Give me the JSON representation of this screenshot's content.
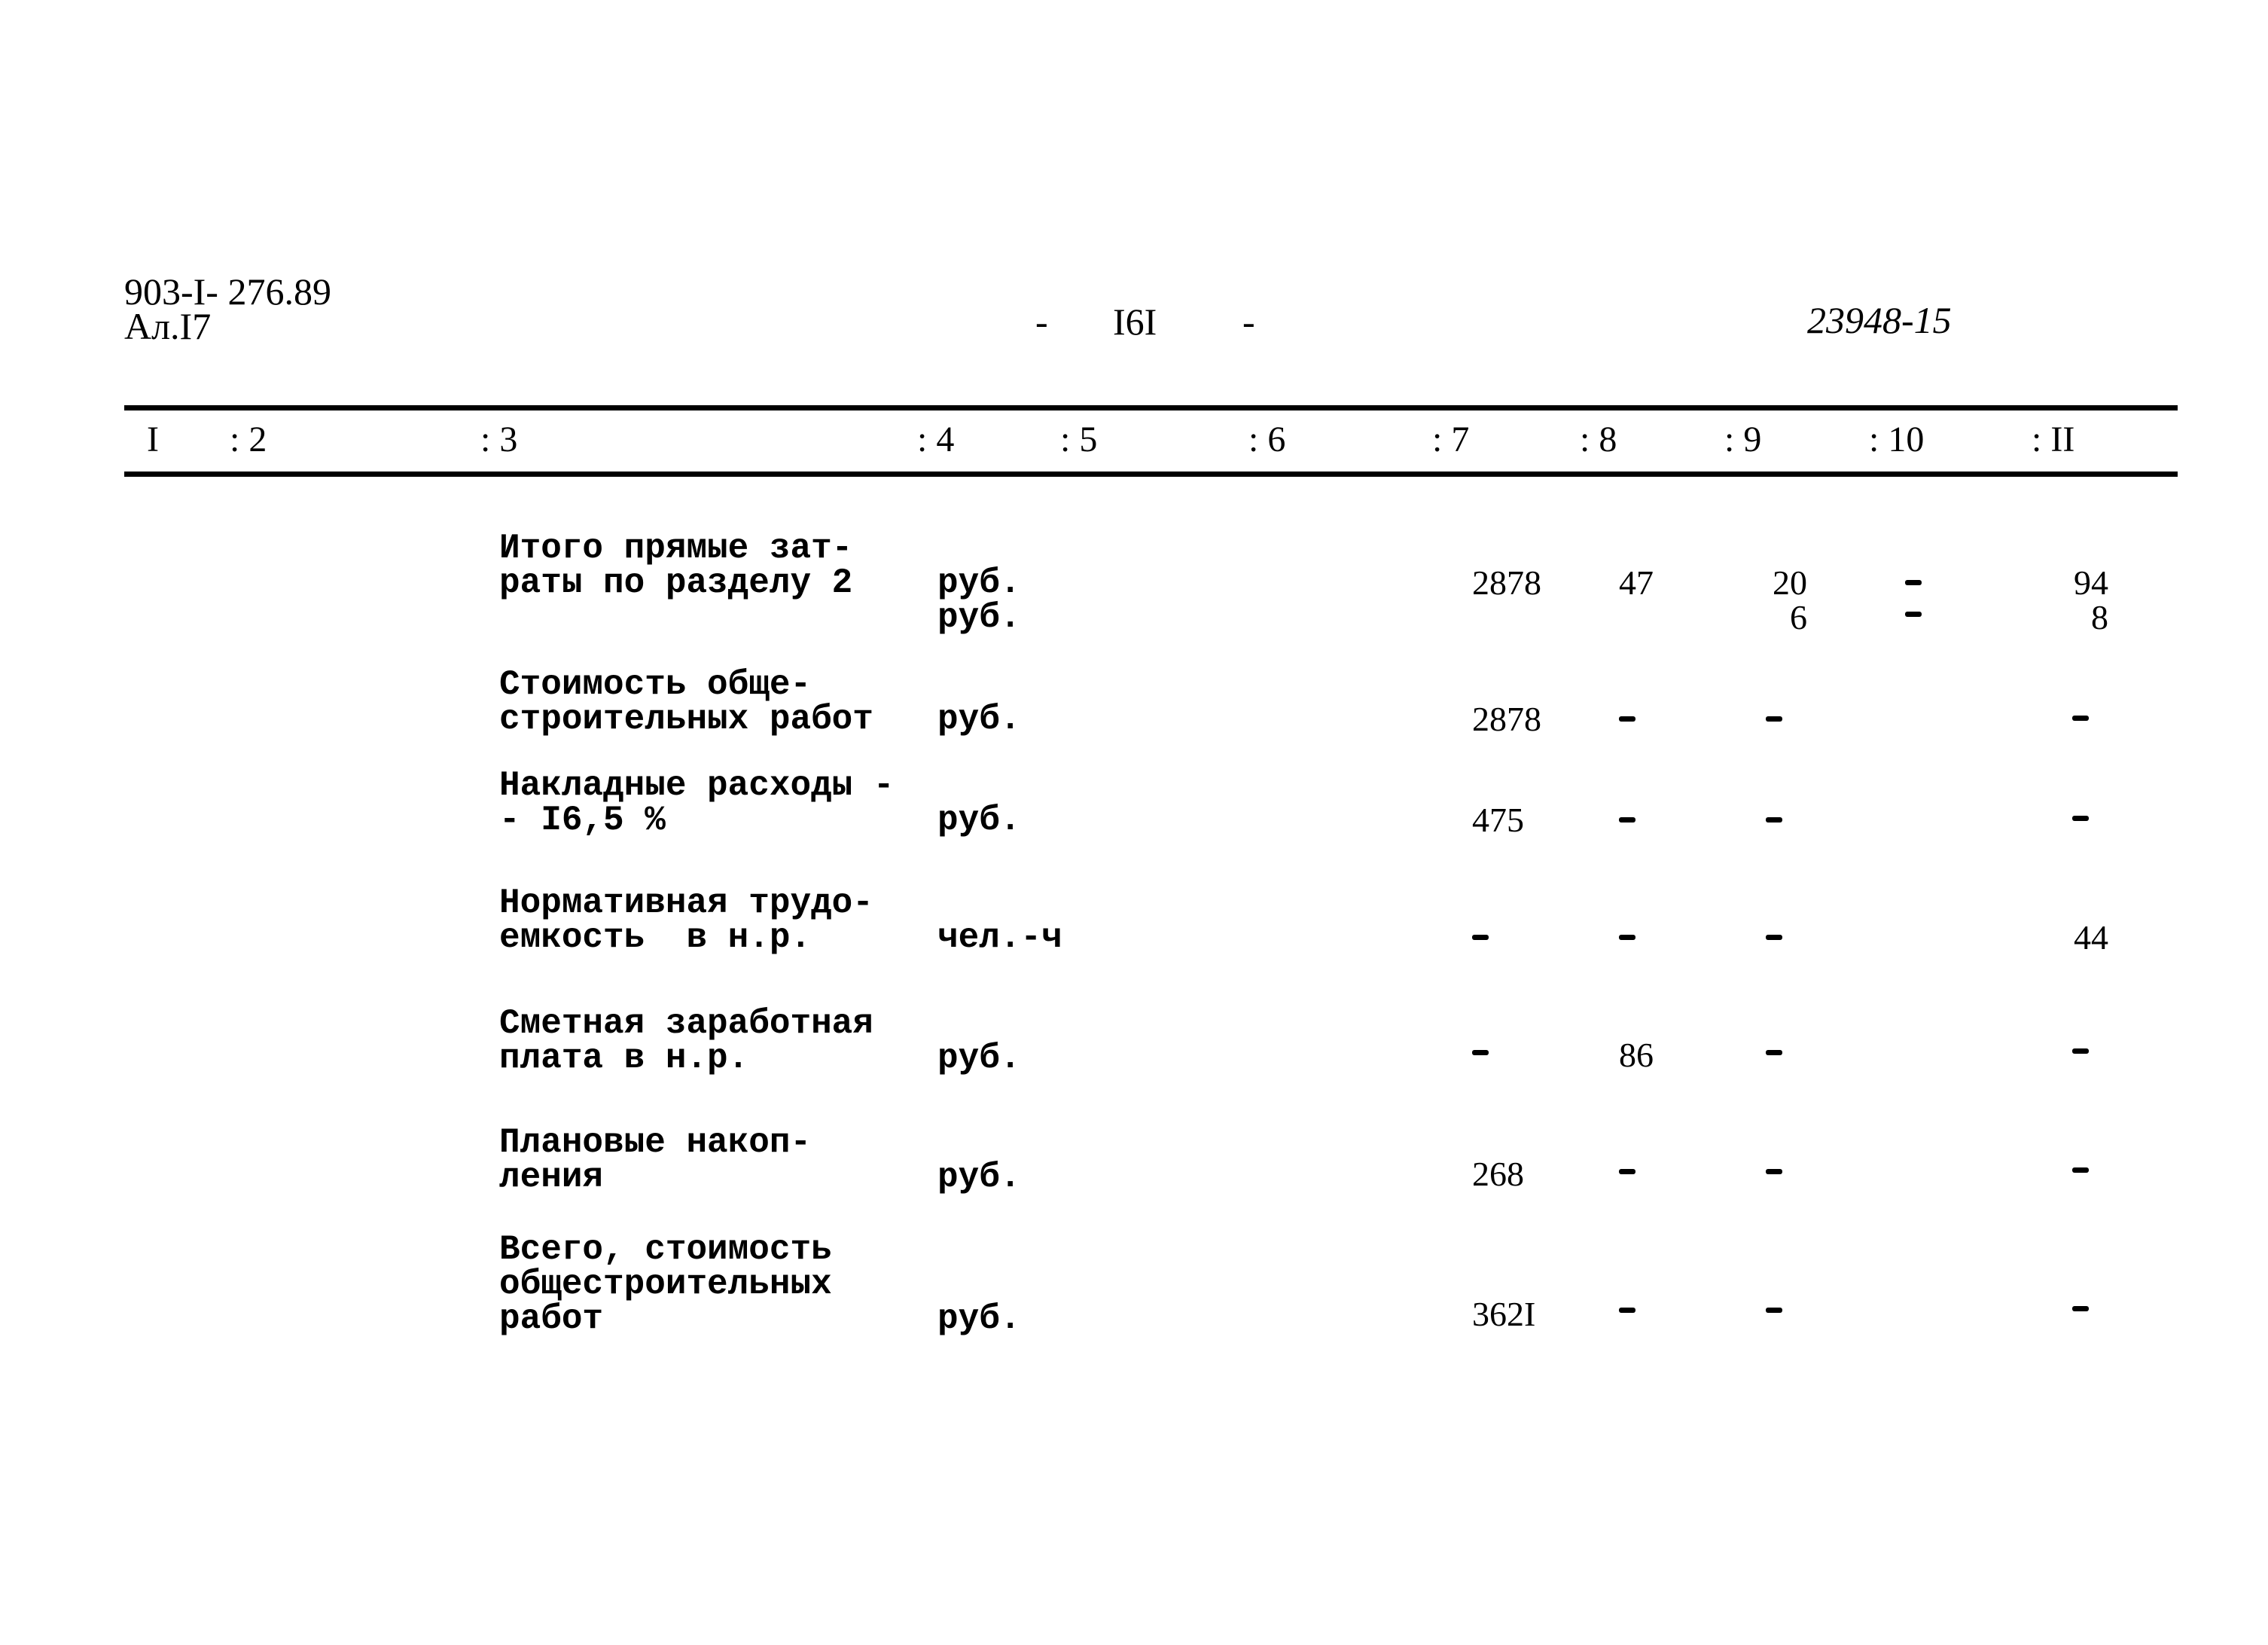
{
  "header": {
    "doc_code": "903-I- 276.89",
    "sheet": "Ал.I7",
    "page_number": "I6I",
    "page_dash_left": "-",
    "page_dash_right": "-",
    "archive_number": "23948-15"
  },
  "table": {
    "column_headers": [
      "I",
      ": 2",
      ": 3",
      ": 4",
      ": 5",
      ": 6",
      ": 7",
      ": 8",
      ": 9",
      ": 10",
      ": II"
    ],
    "rows": [
      {
        "description": [
          "Итого прямые зат-",
          "раты по разделу 2"
        ],
        "units": [
          "руб.",
          "руб."
        ],
        "col7": "2878",
        "col8": "47",
        "col9": [
          "20",
          "6"
        ],
        "col10": [
          "-",
          "-"
        ],
        "col11": [
          "94",
          "8"
        ]
      },
      {
        "description": [
          "Стоимость обще-",
          "строительных работ"
        ],
        "units": [
          "руб."
        ],
        "col7": "2878",
        "col8": "-",
        "col9": "-",
        "col11": "-"
      },
      {
        "description": [
          "Накладные расходы -",
          "- I6,5 %"
        ],
        "units": [
          "руб."
        ],
        "col7": "475",
        "col8": "-",
        "col9": "-",
        "col11": "-"
      },
      {
        "description": [
          "Нормативная трудо-",
          "емкость  в н.р."
        ],
        "units": [
          "чел.-ч"
        ],
        "col7": "-",
        "col8": "-",
        "col9": "-",
        "col11": "44"
      },
      {
        "description": [
          "Сметная заработная",
          "плата в н.р."
        ],
        "units": [
          "руб."
        ],
        "col7": "-",
        "col8": "86",
        "col9": "-",
        "col11": "-"
      },
      {
        "description": [
          "Плановые накоп-",
          "ления"
        ],
        "units": [
          "руб."
        ],
        "col7": "268",
        "col8": "-",
        "col9": "-",
        "col11": "-"
      },
      {
        "description": [
          "Всего, стоимость",
          "общестроительных",
          "работ"
        ],
        "units": [
          "руб."
        ],
        "col7": "362I",
        "col8": "-",
        "col9": "-",
        "col11": "-"
      }
    ]
  }
}
